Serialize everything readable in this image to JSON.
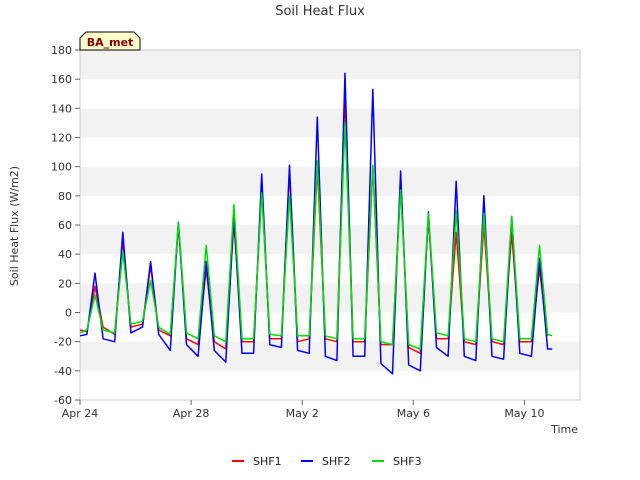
{
  "chart_data": {
    "type": "line",
    "title": "Soil Heat Flux",
    "xlabel": "Time",
    "ylabel": "Soil Heat Flux (W/m2)",
    "badge": "BA_met",
    "ylim": [
      -60,
      180
    ],
    "yticks": [
      -60,
      -40,
      -20,
      0,
      20,
      40,
      60,
      80,
      100,
      120,
      140,
      160,
      180
    ],
    "xlim": [
      "2023-04-24",
      "2023-05-12"
    ],
    "xticks": [
      "Apr 24",
      "Apr 28",
      "May 2",
      "May 6",
      "May 10"
    ],
    "grid": "horizontal bands",
    "legend_position": "bottom",
    "series": [
      {
        "name": "SHF1",
        "color": "#ff0000",
        "points": [
          [
            "Apr 24 00:00",
            -12
          ],
          [
            "Apr 24 06:00",
            -13
          ],
          [
            "Apr 24 13:00",
            18
          ],
          [
            "Apr 24 20:00",
            -10
          ],
          [
            "Apr 25 06:00",
            -15
          ],
          [
            "Apr 25 13:00",
            50
          ],
          [
            "Apr 25 20:00",
            -10
          ],
          [
            "Apr 26 06:00",
            -8
          ],
          [
            "Apr 26 13:00",
            32
          ],
          [
            "Apr 26 20:00",
            -12
          ],
          [
            "Apr 27 06:00",
            -16
          ],
          [
            "Apr 27 13:00",
            60
          ],
          [
            "Apr 27 20:00",
            -18
          ],
          [
            "Apr 28 06:00",
            -22
          ],
          [
            "Apr 28 13:00",
            30
          ],
          [
            "Apr 28 20:00",
            -20
          ],
          [
            "Apr 29 06:00",
            -25
          ],
          [
            "Apr 29 13:00",
            62
          ],
          [
            "Apr 29 20:00",
            -20
          ],
          [
            "Apr 30 06:00",
            -20
          ],
          [
            "Apr 30 13:00",
            85
          ],
          [
            "Apr 30 20:00",
            -18
          ],
          [
            "May 1 06:00",
            -18
          ],
          [
            "May 1 13:00",
            97
          ],
          [
            "May 1 20:00",
            -20
          ],
          [
            "May 2 06:00",
            -18
          ],
          [
            "May 2 13:00",
            100
          ],
          [
            "May 2 20:00",
            -18
          ],
          [
            "May 3 06:00",
            -20
          ],
          [
            "May 3 13:00",
            150
          ],
          [
            "May 3 20:00",
            -20
          ],
          [
            "May 4 06:00",
            -20
          ],
          [
            "May 4 13:00",
            100
          ],
          [
            "May 4 20:00",
            -22
          ],
          [
            "May 5 06:00",
            -22
          ],
          [
            "May 5 13:00",
            88
          ],
          [
            "May 5 20:00",
            -24
          ],
          [
            "May 6 06:00",
            -28
          ],
          [
            "May 6 13:00",
            65
          ],
          [
            "May 6 20:00",
            -18
          ],
          [
            "May 7 06:00",
            -18
          ],
          [
            "May 7 13:00",
            55
          ],
          [
            "May 7 20:00",
            -20
          ],
          [
            "May 8 06:00",
            -22
          ],
          [
            "May 8 13:00",
            60
          ],
          [
            "May 8 20:00",
            -20
          ],
          [
            "May 9 06:00",
            -22
          ],
          [
            "May 9 13:00",
            55
          ],
          [
            "May 9 20:00",
            -20
          ],
          [
            "May 10 06:00",
            -20
          ],
          [
            "May 10 13:00",
            30
          ],
          [
            "May 10 20:00",
            -16
          ]
        ]
      },
      {
        "name": "SHF2",
        "color": "#0000ff",
        "points": [
          [
            "Apr 24 00:00",
            -16
          ],
          [
            "Apr 24 06:00",
            -15
          ],
          [
            "Apr 24 13:00",
            27
          ],
          [
            "Apr 24 20:00",
            -18
          ],
          [
            "Apr 25 06:00",
            -20
          ],
          [
            "Apr 25 13:00",
            55
          ],
          [
            "Apr 25 20:00",
            -14
          ],
          [
            "Apr 26 06:00",
            -10
          ],
          [
            "Apr 26 13:00",
            35
          ],
          [
            "Apr 26 20:00",
            -15
          ],
          [
            "Apr 27 06:00",
            -26
          ],
          [
            "Apr 27 13:00",
            62
          ],
          [
            "Apr 27 20:00",
            -22
          ],
          [
            "Apr 28 06:00",
            -30
          ],
          [
            "Apr 28 13:00",
            35
          ],
          [
            "Apr 28 20:00",
            -26
          ],
          [
            "Apr 29 06:00",
            -34
          ],
          [
            "Apr 29 13:00",
            67
          ],
          [
            "Apr 29 20:00",
            -28
          ],
          [
            "Apr 30 06:00",
            -28
          ],
          [
            "Apr 30 13:00",
            95
          ],
          [
            "Apr 30 20:00",
            -22
          ],
          [
            "May 1 06:00",
            -24
          ],
          [
            "May 1 13:00",
            101
          ],
          [
            "May 1 20:00",
            -26
          ],
          [
            "May 2 06:00",
            -28
          ],
          [
            "May 2 13:00",
            134
          ],
          [
            "May 2 20:00",
            -30
          ],
          [
            "May 3 06:00",
            -33
          ],
          [
            "May 3 13:00",
            164
          ],
          [
            "May 3 20:00",
            -30
          ],
          [
            "May 4 06:00",
            -30
          ],
          [
            "May 4 13:00",
            153
          ],
          [
            "May 4 20:00",
            -35
          ],
          [
            "May 5 06:00",
            -42
          ],
          [
            "May 5 13:00",
            97
          ],
          [
            "May 5 20:00",
            -36
          ],
          [
            "May 6 06:00",
            -40
          ],
          [
            "May 6 13:00",
            69
          ],
          [
            "May 6 20:00",
            -24
          ],
          [
            "May 7 06:00",
            -30
          ],
          [
            "May 7 13:00",
            90
          ],
          [
            "May 7 20:00",
            -30
          ],
          [
            "May 8 06:00",
            -33
          ],
          [
            "May 8 13:00",
            80
          ],
          [
            "May 8 20:00",
            -30
          ],
          [
            "May 9 06:00",
            -32
          ],
          [
            "May 9 13:00",
            66
          ],
          [
            "May 9 20:00",
            -28
          ],
          [
            "May 10 06:00",
            -30
          ],
          [
            "May 10 13:00",
            37
          ],
          [
            "May 10 20:00",
            -25
          ],
          [
            "May 11 00:00",
            -25
          ]
        ]
      },
      {
        "name": "SHF3",
        "color": "#00dd00",
        "points": [
          [
            "Apr 24 00:00",
            -14
          ],
          [
            "Apr 24 06:00",
            -12
          ],
          [
            "Apr 24 13:00",
            12
          ],
          [
            "Apr 24 20:00",
            -12
          ],
          [
            "Apr 25 06:00",
            -14
          ],
          [
            "Apr 25 13:00",
            42
          ],
          [
            "Apr 25 20:00",
            -8
          ],
          [
            "Apr 26 06:00",
            -6
          ],
          [
            "Apr 26 13:00",
            22
          ],
          [
            "Apr 26 20:00",
            -10
          ],
          [
            "Apr 27 06:00",
            -15
          ],
          [
            "Apr 27 13:00",
            62
          ],
          [
            "Apr 27 20:00",
            -14
          ],
          [
            "Apr 28 06:00",
            -18
          ],
          [
            "Apr 28 13:00",
            46
          ],
          [
            "Apr 28 20:00",
            -16
          ],
          [
            "Apr 29 06:00",
            -20
          ],
          [
            "Apr 29 13:00",
            74
          ],
          [
            "Apr 29 20:00",
            -18
          ],
          [
            "Apr 30 06:00",
            -18
          ],
          [
            "Apr 30 13:00",
            82
          ],
          [
            "Apr 30 20:00",
            -15
          ],
          [
            "May 1 06:00",
            -16
          ],
          [
            "May 1 13:00",
            80
          ],
          [
            "May 1 20:00",
            -16
          ],
          [
            "May 2 06:00",
            -16
          ],
          [
            "May 2 13:00",
            104
          ],
          [
            "May 2 20:00",
            -16
          ],
          [
            "May 3 06:00",
            -18
          ],
          [
            "May 3 13:00",
            130
          ],
          [
            "May 3 20:00",
            -18
          ],
          [
            "May 4 06:00",
            -18
          ],
          [
            "May 4 13:00",
            101
          ],
          [
            "May 4 20:00",
            -20
          ],
          [
            "May 5 06:00",
            -22
          ],
          [
            "May 5 13:00",
            84
          ],
          [
            "May 5 20:00",
            -22
          ],
          [
            "May 6 06:00",
            -25
          ],
          [
            "May 6 13:00",
            68
          ],
          [
            "May 6 20:00",
            -14
          ],
          [
            "May 7 06:00",
            -16
          ],
          [
            "May 7 13:00",
            70
          ],
          [
            "May 7 20:00",
            -18
          ],
          [
            "May 8 06:00",
            -20
          ],
          [
            "May 8 13:00",
            68
          ],
          [
            "May 8 20:00",
            -18
          ],
          [
            "May 9 06:00",
            -20
          ],
          [
            "May 9 13:00",
            66
          ],
          [
            "May 9 20:00",
            -18
          ],
          [
            "May 10 06:00",
            -18
          ],
          [
            "May 10 13:00",
            46
          ],
          [
            "May 10 20:00",
            -15
          ],
          [
            "May 11 00:00",
            -16
          ]
        ]
      }
    ]
  }
}
